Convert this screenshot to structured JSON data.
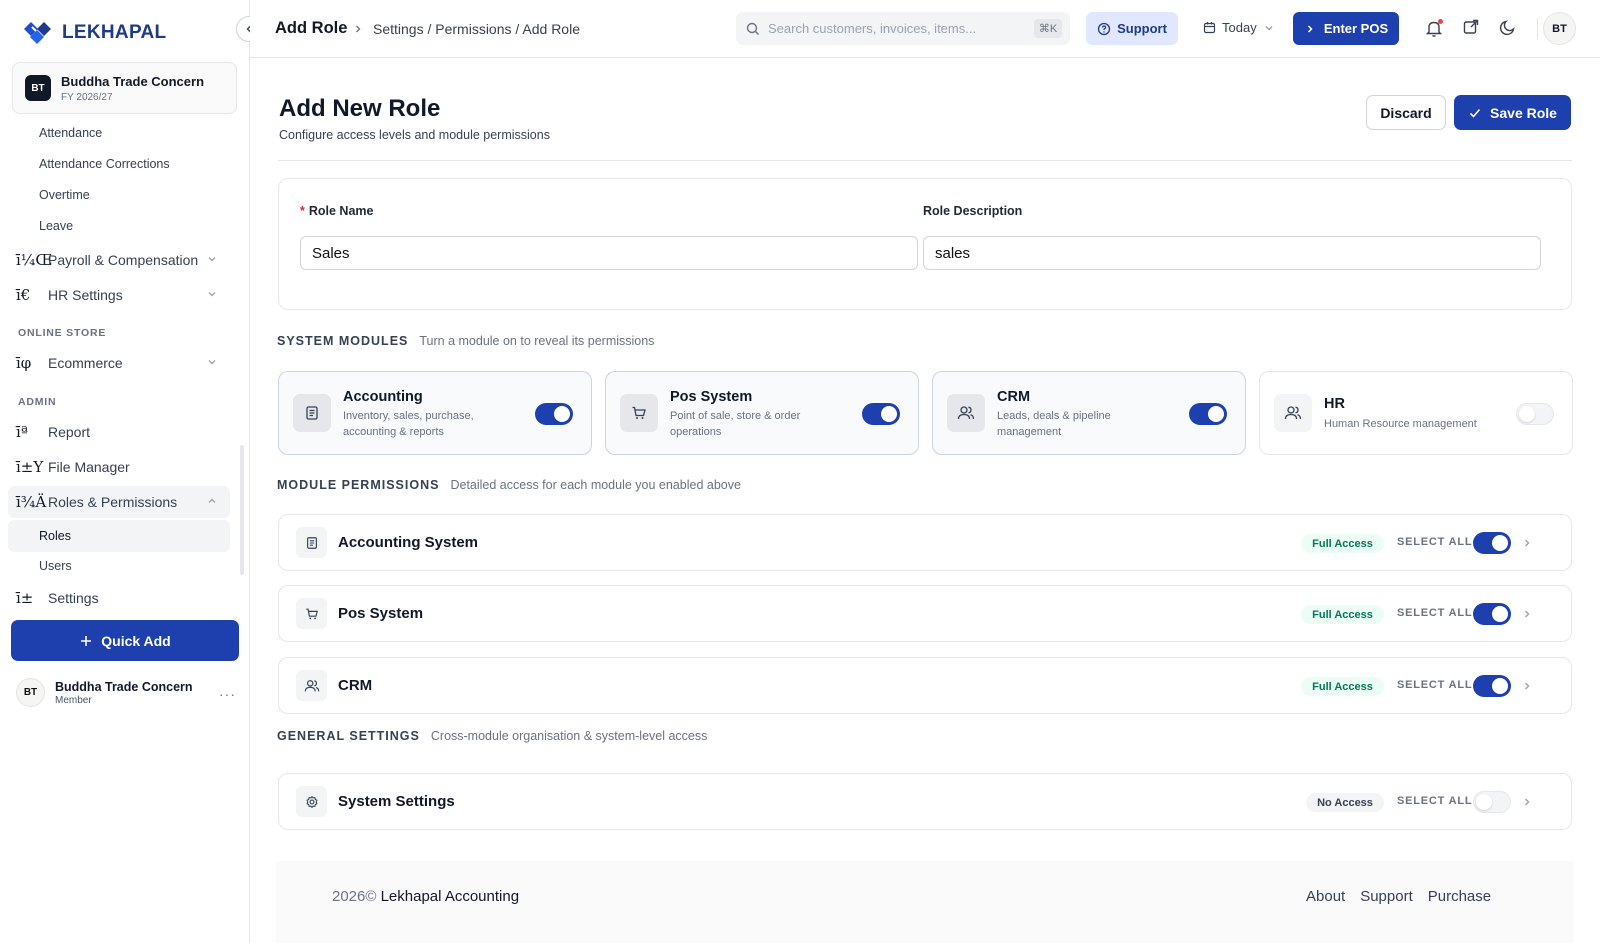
{
  "sidebar": {
    "logo_text": "LEKHAPAL",
    "company": {
      "initials": "BT",
      "name": "Buddha Trade Concern",
      "fy": "FY 2026/27"
    },
    "sub_items_top": [
      "Attendance",
      "Attendance Corrections",
      "Overtime",
      "Leave"
    ],
    "items": {
      "payroll": {
        "glyph": "ī¼Œ",
        "label": "Payroll & Compensation"
      },
      "hr_settings": {
        "glyph": "ī€",
        "label": "HR Settings"
      },
      "ecommerce": {
        "glyph": "īφ",
        "label": "Ecommerce"
      },
      "report": {
        "glyph": "īª",
        "label": "Report"
      },
      "file_manager": {
        "glyph": "ī±Y",
        "label": "File Manager"
      },
      "roles": {
        "glyph": "ī¾Ä",
        "label": "Roles & Permissions"
      },
      "settings": {
        "glyph": "ī±",
        "label": "Settings"
      }
    },
    "sections": {
      "online_store": "ONLINE STORE",
      "admin": "ADMIN"
    },
    "roles_children": [
      "Roles",
      "Users"
    ],
    "quick_add": "Quick Add",
    "user": {
      "initials": "BT",
      "name": "Buddha Trade Concern",
      "role": "Member",
      "more": "···"
    }
  },
  "topbar": {
    "title": "Add Role",
    "breadcrumb": "Settings / Permissions / Add Role",
    "search_placeholder": "Search customers, invoices, items...",
    "search_shortcut": "⌘K",
    "support": "Support",
    "date_filter": "Today",
    "enter_pos": "Enter POS",
    "avatar_initials": "BT"
  },
  "main": {
    "title": "Add New Role",
    "subtitle": "Configure access levels and module permissions",
    "discard": "Discard",
    "save": "Save Role",
    "form": {
      "role_name_label": "Role Name",
      "role_name_value": "Sales",
      "role_desc_label": "Role Description",
      "role_desc_value": "sales"
    },
    "system_modules": {
      "title": "SYSTEM MODULES",
      "desc": "Turn a module on to reveal its permissions",
      "items": [
        {
          "name": "Accounting",
          "desc": "Inventory, sales, purchase, accounting & reports",
          "icon": "document-icon",
          "enabled": true
        },
        {
          "name": "Pos System",
          "desc": "Point of sale, store & order operations",
          "icon": "cart-icon",
          "enabled": true
        },
        {
          "name": "CRM",
          "desc": "Leads, deals & pipeline management",
          "icon": "users-icon",
          "enabled": true
        },
        {
          "name": "HR",
          "desc": "Human Resource management",
          "icon": "users-icon",
          "enabled": false
        }
      ]
    },
    "module_permissions": {
      "title": "MODULE PERMISSIONS",
      "desc": "Detailed access for each module you enabled above",
      "rows": [
        {
          "name": "Accounting System",
          "badge": "Full Access",
          "select_all": "SELECT ALL",
          "enabled": true
        },
        {
          "name": "Pos System",
          "badge": "Full Access",
          "select_all": "SELECT ALL",
          "enabled": true
        },
        {
          "name": "CRM",
          "badge": "Full Access",
          "select_all": "SELECT ALL",
          "enabled": true
        }
      ]
    },
    "general_settings": {
      "title": "GENERAL SETTINGS",
      "desc": "Cross-module organisation & system-level access",
      "rows": [
        {
          "name": "System Settings",
          "badge": "No Access",
          "select_all": "SELECT ALL",
          "enabled": false
        }
      ]
    }
  },
  "footer": {
    "year": "2026©",
    "brand": "Lekhapal Accounting",
    "links": [
      "About",
      "Support",
      "Purchase"
    ]
  },
  "colors": {
    "primary": "#1e40af",
    "success_bg": "#ecfdf5",
    "success_text": "#047857"
  }
}
